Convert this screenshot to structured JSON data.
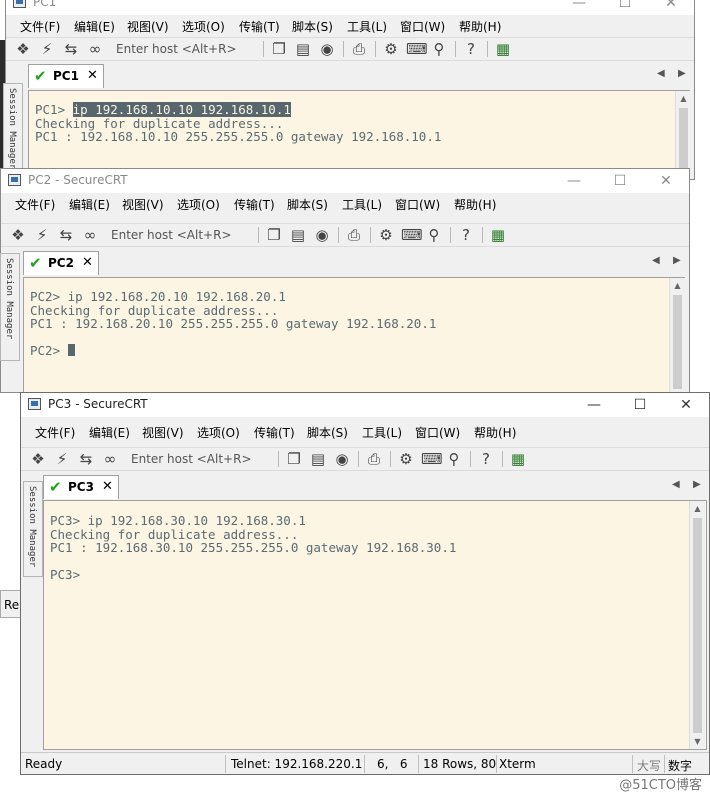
{
  "menu": [
    "文件(F)",
    "编辑(E)",
    "视图(V)",
    "选项(O)",
    "传输(T)",
    "脚本(S)",
    "工具(L)",
    "窗口(W)",
    "帮助(H)"
  ],
  "host_placeholder": "Enter host <Alt+R>",
  "session_manager_label": "Session Manager",
  "pc1": {
    "title": "PC1",
    "tab": "PC1",
    "lines": [
      "Checking for duplicate address...",
      "PC1 : 192.168.10.10 255.255.255.0 gateway 192.168.10.1"
    ],
    "prompt": "PC1> ",
    "command": "ip 192.168.10.10 192.168.10.1"
  },
  "pc2": {
    "title": "PC2 - SecureCRT",
    "tab": "PC2",
    "lines": [
      "PC2> ip 192.168.20.10 192.168.20.1",
      "Checking for duplicate address...",
      "PC1 : 192.168.20.10 255.255.255.0 gateway 192.168.20.1",
      "",
      "PC2> "
    ]
  },
  "pc3": {
    "title": "PC3 - SecureCRT",
    "tab": "PC3",
    "lines": [
      "PC3> ip 192.168.30.10 192.168.30.1",
      "Checking for duplicate address...",
      "PC1 : 192.168.30.10 255.255.255.0 gateway 192.168.30.1",
      "",
      "PC3>"
    ]
  },
  "status": {
    "ready": "Ready",
    "telnet": "Telnet: 192.168.220.1",
    "cursor_pos": "6,   6",
    "size": "18 Rows, 80",
    "term_type": "Xterm",
    "caps": "大写",
    "num": "数字"
  },
  "left_fragment": "Re",
  "watermark": "@51CTO博客",
  "colors": {
    "terminal_bg": "#fcf5e3",
    "terminal_text": "#5c6a72",
    "connected_check": "#1ea51e"
  }
}
